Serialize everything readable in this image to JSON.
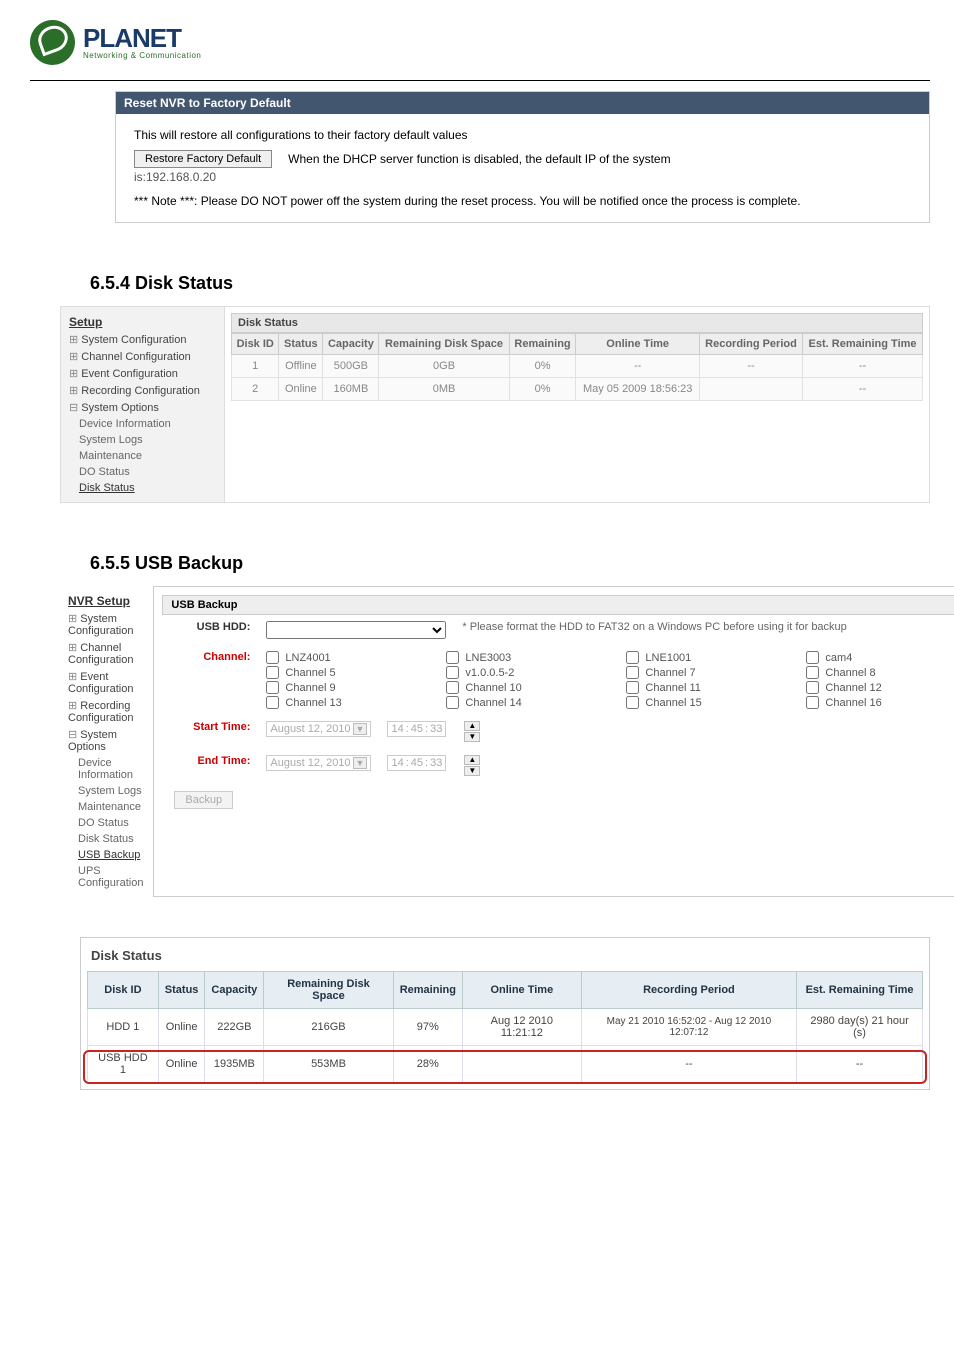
{
  "logo": {
    "title": "PLANET",
    "subtitle": "Networking & Communication"
  },
  "reset_panel": {
    "title": "Reset NVR to Factory Default",
    "intro": "This will restore all configurations to their factory default values",
    "button_label": "Restore Factory Default",
    "after_button": "When the DHCP server function is disabled, the default IP of the system",
    "ip_line": "is:192.168.0.20",
    "note": "*** Note ***: Please DO NOT power off the system during the reset process. You will be notified once the process is complete."
  },
  "sec654": {
    "heading": "6.5.4 Disk Status",
    "sidebar_title": "Setup",
    "tree": {
      "system_config": "System Configuration",
      "channel_config": "Channel Configuration",
      "event_config": "Event Configuration",
      "recording_config": "Recording Configuration",
      "system_options": "System Options",
      "children": {
        "dev_info": "Device Information",
        "sys_logs": "System Logs",
        "maintenance": "Maintenance",
        "do_status": "DO Status",
        "disk_status": "Disk Status"
      }
    },
    "panel_title": "Disk Status",
    "cols": {
      "disk_id": "Disk ID",
      "status": "Status",
      "capacity": "Capacity",
      "rds": "Remaining Disk Space",
      "remaining": "Remaining",
      "online_time": "Online Time",
      "rec_period": "Recording Period",
      "est": "Est. Remaining Time"
    },
    "rows": [
      {
        "id": "1",
        "status": "Offline",
        "capacity": "500GB",
        "rds": "0GB",
        "remaining": "0%",
        "online": "--",
        "rec": "--",
        "est": "--"
      },
      {
        "id": "2",
        "status": "Online",
        "capacity": "160MB",
        "rds": "0MB",
        "remaining": "0%",
        "online": "May 05 2009 18:56:23",
        "rec": "",
        "est": "--"
      }
    ]
  },
  "sec655": {
    "heading": "6.5.5 USB Backup",
    "sidebar_title": "NVR Setup",
    "tree": {
      "system_config": "System Configuration",
      "channel_config": "Channel Configuration",
      "event_config": "Event Configuration",
      "recording_config": "Recording Configuration",
      "system_options": "System Options",
      "children": {
        "dev_info": "Device Information",
        "sys_logs": "System Logs",
        "maintenance": "Maintenance",
        "do_status": "DO Status",
        "disk_status": "Disk Status",
        "usb_backup": "USB Backup",
        "ups_config": "UPS Configuration"
      }
    },
    "panel_title": "USB Backup",
    "labels": {
      "usb_hdd": "USB HDD:",
      "usb_hint": "* Please format the HDD to FAT32 on a Windows PC before using it for backup",
      "channel": "Channel:",
      "start": "Start Time:",
      "end": "End Time:",
      "backup": "Backup"
    },
    "channels": [
      [
        "LNZ4001",
        "LNE3003",
        "LNE1001",
        "cam4"
      ],
      [
        "Channel 5",
        "v1.0.0.5-2",
        "Channel 7",
        "Channel 8"
      ],
      [
        "Channel 9",
        "Channel 10",
        "Channel 11",
        "Channel 12"
      ],
      [
        "Channel 13",
        "Channel 14",
        "Channel 15",
        "Channel 16"
      ]
    ],
    "start_date": "August 12, 2010",
    "start_time": {
      "h": "14",
      "m": "45",
      "s": "33"
    },
    "end_date": "August 12, 2010",
    "end_time": {
      "h": "14",
      "m": "45",
      "s": "33"
    }
  },
  "bottom": {
    "title": "Disk Status",
    "cols": {
      "disk_id": "Disk ID",
      "status": "Status",
      "capacity": "Capacity",
      "rds": "Remaining Disk Space",
      "remaining": "Remaining",
      "online_time": "Online Time",
      "rec_period": "Recording Period",
      "est": "Est. Remaining Time"
    },
    "rows": [
      {
        "id": "HDD 1",
        "status": "Online",
        "capacity": "222GB",
        "rds": "216GB",
        "remaining": "97%",
        "online": "Aug 12 2010 11:21:12",
        "rec": "May 21 2010 16:52:02 - Aug 12 2010 12:07:12",
        "est": "2980 day(s) 21 hour (s)"
      },
      {
        "id": "USB HDD 1",
        "status": "Online",
        "capacity": "1935MB",
        "rds": "553MB",
        "remaining": "28%",
        "online": "",
        "rec": "--",
        "est": "--"
      }
    ]
  }
}
